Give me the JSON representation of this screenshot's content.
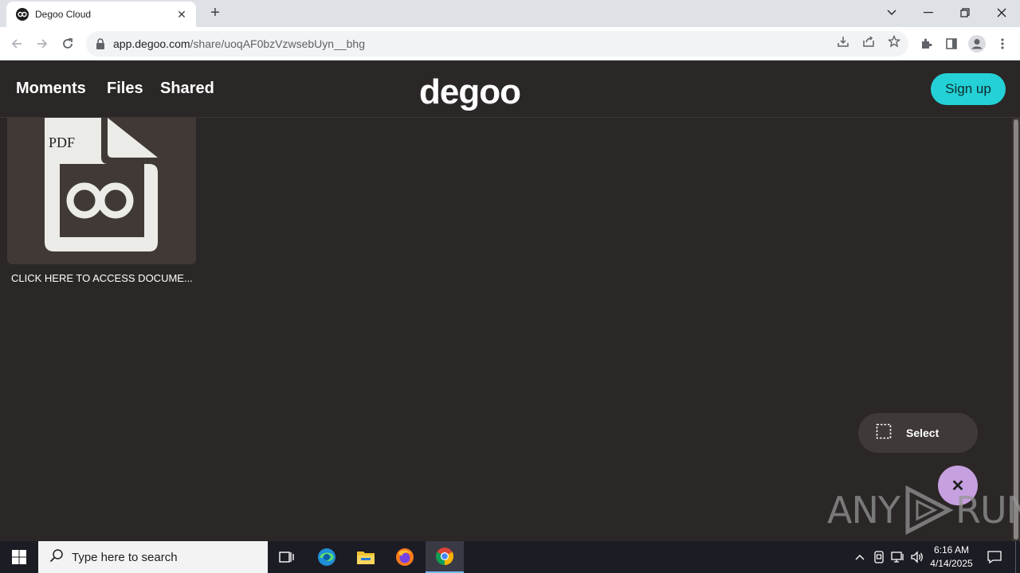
{
  "browser": {
    "tab_title": "Degoo Cloud",
    "url_host": "app.degoo.com",
    "url_path": "/share/uoqAF0bzVzwsebUyn__bhg"
  },
  "app": {
    "nav": [
      "Moments",
      "Files",
      "Shared"
    ],
    "logo": "degoo",
    "signup_label": "Sign up"
  },
  "file": {
    "badge": "PDF",
    "name": "CLICK HERE TO ACCESS DOCUME..."
  },
  "actions": {
    "select_label": "Select",
    "close_symbol": "✕"
  },
  "watermark": {
    "text_left": "ANY",
    "text_right": "RUN"
  },
  "taskbar": {
    "search_placeholder": "Type here to search",
    "time": "6:16 AM",
    "date": "4/14/2025"
  },
  "colors": {
    "background": "#2b2726",
    "accent_signup": "#23d1d6",
    "fab": "#c7a0e0",
    "card": "#403936"
  }
}
